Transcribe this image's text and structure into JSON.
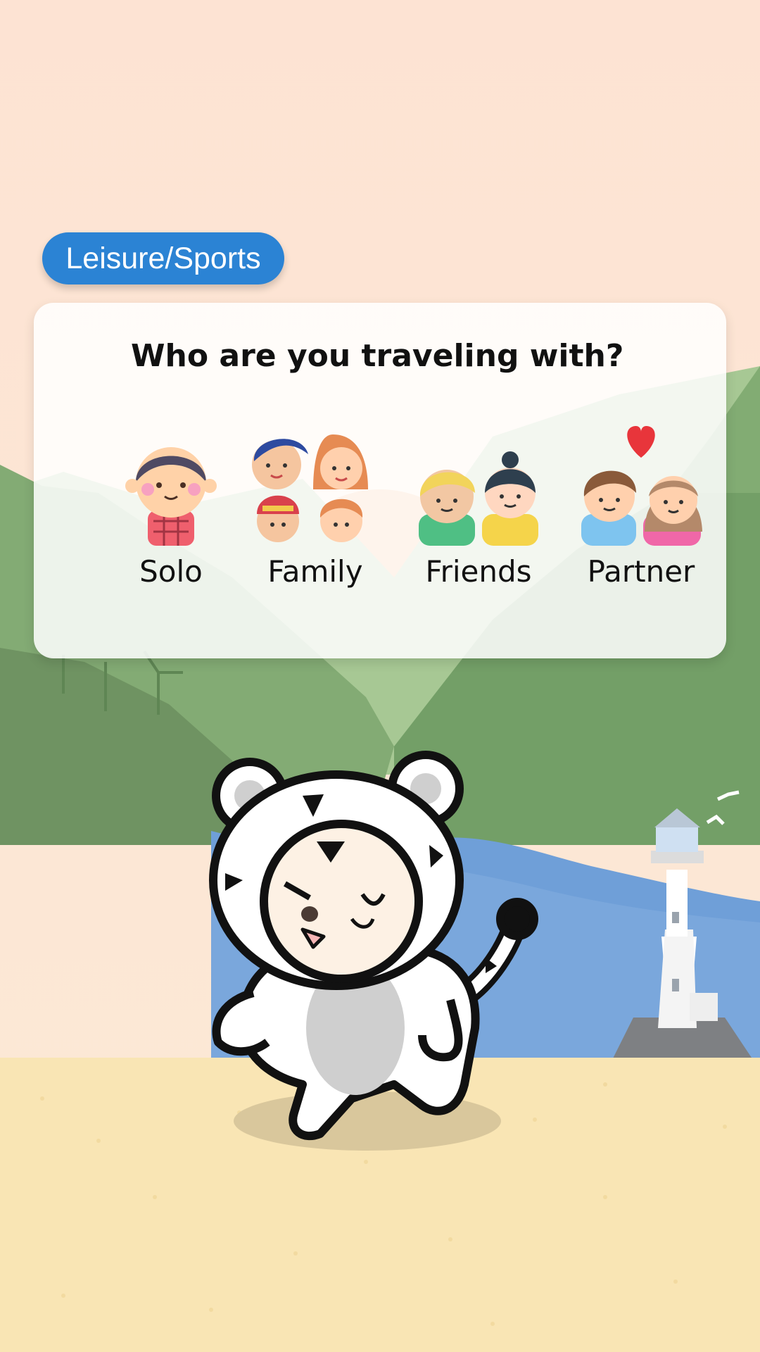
{
  "category": {
    "label": "Leisure/Sports"
  },
  "question": {
    "text": "Who are you traveling with?"
  },
  "options": [
    {
      "label": "Solo",
      "icon": "solo-person-icon"
    },
    {
      "label": "Family",
      "icon": "family-icon"
    },
    {
      "label": "Friends",
      "icon": "friends-icon"
    },
    {
      "label": "Partner",
      "icon": "couple-heart-icon"
    }
  ],
  "colors": {
    "accent": "#2b83d4",
    "sky": "#fde5d4",
    "sand": "#f9e5b4",
    "water": "#6f9fd8",
    "hills": "#7aa36c"
  }
}
